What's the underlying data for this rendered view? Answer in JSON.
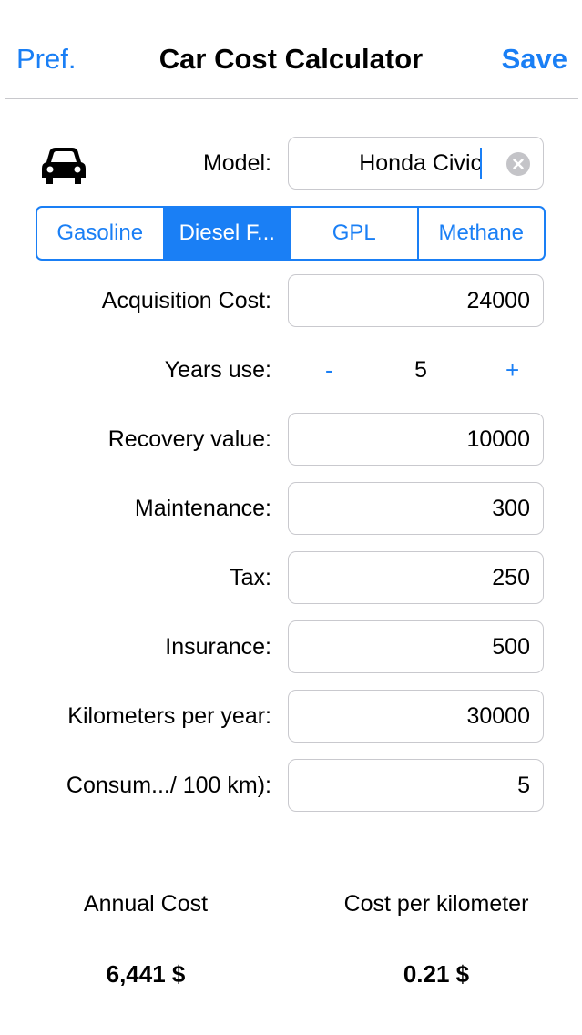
{
  "navbar": {
    "left_label": "Pref.",
    "title": "Car Cost Calculator",
    "right_label": "Save"
  },
  "model": {
    "label": "Model:",
    "value": "Honda Civic"
  },
  "fuel_types": {
    "options": [
      "Gasoline",
      "Diesel F...",
      "GPL",
      "Methane"
    ],
    "selected": "Diesel F..."
  },
  "fields": {
    "acquisition_cost": {
      "label": "Acquisition Cost:",
      "value": "24000"
    },
    "years_use": {
      "label": "Years use:",
      "value": "5",
      "minus": "-",
      "plus": "+"
    },
    "recovery_value": {
      "label": "Recovery value:",
      "value": "10000"
    },
    "maintenance": {
      "label": "Maintenance:",
      "value": "300"
    },
    "tax": {
      "label": "Tax:",
      "value": "250"
    },
    "insurance": {
      "label": "Insurance:",
      "value": "500"
    },
    "km_per_year": {
      "label": "Kilometers per year:",
      "value": "30000"
    },
    "consumption": {
      "label": "Consum.../ 100 km):",
      "value": "5"
    }
  },
  "results": {
    "annual_cost_label": "Annual Cost",
    "annual_cost_value": "6,441 $",
    "cost_per_km_label": "Cost per kilometer",
    "cost_per_km_value": "0.21 $"
  },
  "colors": {
    "accent": "#1a7ff5",
    "border": "#c9c9ce"
  },
  "icons": {
    "car": "car-icon",
    "clear": "clear-icon"
  }
}
